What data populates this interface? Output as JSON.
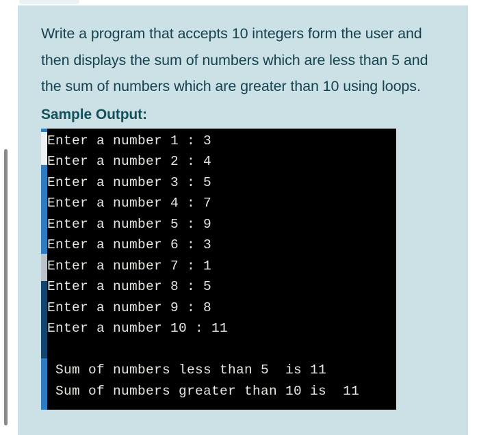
{
  "card": {
    "background_color": "#cbe1e6",
    "question_text": "Write a program that accepts 10 integers form the user and then displays the sum of numbers which are less than 5 and the sum of numbers which are greater than 10 using loops.",
    "sample_output_heading": "Sample Output:",
    "heading_color": "#12505c",
    "text_color": "#17424f"
  },
  "terminal": {
    "background_color": "#000000",
    "text_color": "#e8e6df",
    "rail_color": "#2f7dc0",
    "lines": [
      "Enter a number 1 : 3",
      "Enter a number 2 : 4",
      "Enter a number 3 : 5",
      "Enter a number 4 : 7",
      "Enter a number 5 : 9",
      "Enter a number 6 : 3",
      "Enter a number 7 : 1",
      "Enter a number 8 : 5",
      "Enter a number 9 : 8",
      "Enter a number 10 : 11",
      "",
      " Sum of numbers less than 5  is 11",
      " Sum of numbers greater than 10 is  11"
    ]
  },
  "program_data": {
    "prompt_label": "Enter a number",
    "count": 10,
    "inputs": [
      3,
      4,
      5,
      7,
      9,
      3,
      1,
      5,
      8,
      11
    ],
    "sum_less_than_5_label": "Sum of numbers less than 5  is",
    "sum_less_than_5": 11,
    "sum_greater_than_10_label": "Sum of numbers greater than 10 is",
    "sum_greater_than_10": 11
  }
}
